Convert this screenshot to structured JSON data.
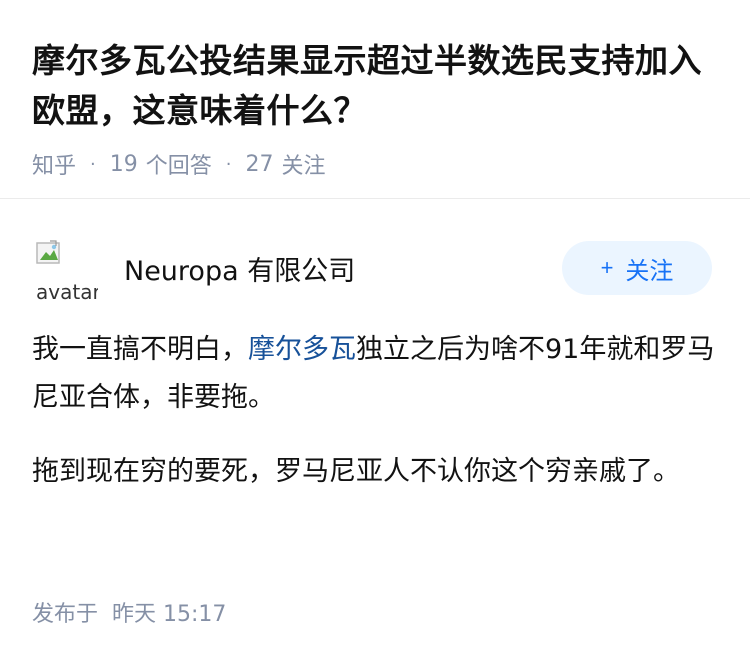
{
  "question": {
    "title": "摩尔多瓦公投结果显示超过半数选民支持加入欧盟，这意味着什么？",
    "source": "知乎",
    "answer_count": "19",
    "answer_label": "个回答",
    "follow_count": "27",
    "follow_label": "关注"
  },
  "author": {
    "avatar_alt": "avatar",
    "name": "Neuropa 有限公司",
    "follow_button": "关注",
    "follow_plus": "+"
  },
  "content": {
    "p1_before": "我一直搞不明白，",
    "p1_link": "摩尔多瓦",
    "p1_after": "独立之后为啥不91年就和罗马尼亚合体，非要拖。",
    "p2": "拖到现在穷的要死，罗马尼亚人不认你这个穷亲戚了。"
  },
  "footer": {
    "published_label": "发布于",
    "published_time": "昨天 15:17"
  },
  "icons": {
    "broken_image": "broken-image-icon"
  },
  "colors": {
    "text": "#121212",
    "meta": "#8590a6",
    "link": "#175199",
    "accent": "#1772f6",
    "button_bg": "#ebf5ff"
  }
}
